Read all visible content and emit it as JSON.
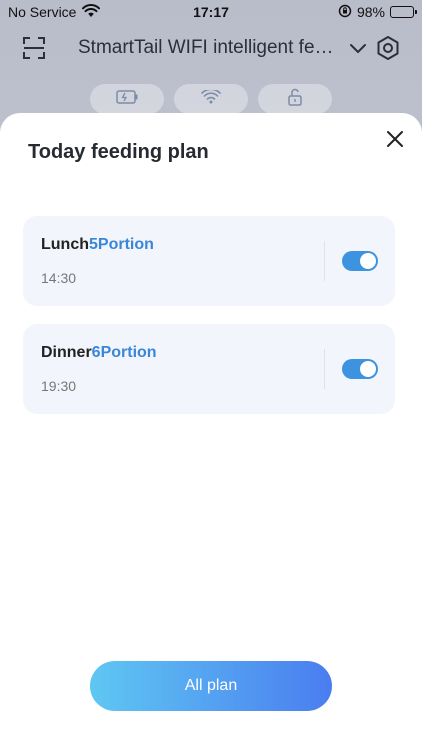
{
  "status_bar": {
    "carrier": "No Service",
    "time": "17:17",
    "battery_percent": "98%",
    "icons": [
      "wifi-icon",
      "orientation-lock-icon",
      "battery-icon"
    ]
  },
  "header": {
    "title": "StmartTail WIFI intelligent feeder",
    "icons": [
      "scan-icon",
      "chevron-down-icon",
      "gear-icon"
    ]
  },
  "device_status": {
    "icons": [
      "battery-status-icon",
      "wifi-status-icon",
      "unlock-icon"
    ]
  },
  "sheet": {
    "title": "Today feeding plan",
    "close_icon": "close-icon",
    "plans": [
      {
        "meal": "Lunch",
        "portion": "5Portion",
        "time": "14:30",
        "enabled": true
      },
      {
        "meal": "Dinner",
        "portion": "6Portion",
        "time": "19:30",
        "enabled": true
      }
    ],
    "all_plan_label": "All plan"
  },
  "colors": {
    "accent": "#3a86d8",
    "toggle_on": "#3d93e0",
    "button_gradient_start": "#5fc7f2",
    "button_gradient_end": "#4a7df0",
    "card_bg": "#f2f5fb"
  }
}
